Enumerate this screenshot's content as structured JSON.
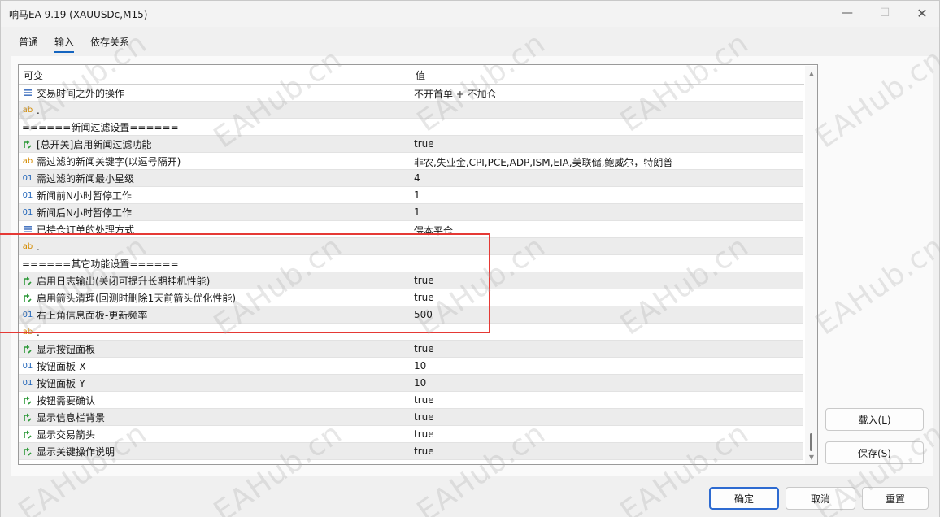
{
  "window": {
    "title": "响马EA 9.19 (XAUUSDc,M15)",
    "minimize": "—",
    "maximize": "☐",
    "close": "✕"
  },
  "tabs": [
    {
      "label": "普通",
      "active": false
    },
    {
      "label": "输入",
      "active": true
    },
    {
      "label": "依存关系",
      "active": false
    }
  ],
  "grid": {
    "col_variable": "可变",
    "col_value": "值",
    "rows": [
      {
        "icon": "menu",
        "name": "交易时间之外的操作",
        "value": "不开首单 + 不加仓"
      },
      {
        "icon": "ab",
        "name": ".",
        "value": ""
      },
      {
        "icon": "",
        "name": "======新闻过滤设置======",
        "value": ""
      },
      {
        "icon": "bool",
        "name": "[总开关]启用新闻过滤功能",
        "value": "true"
      },
      {
        "icon": "ab",
        "name": "需过滤的新闻关键字(以逗号隔开)",
        "value": "非农,失业金,CPI,PCE,ADP,ISM,EIA,美联储,鲍威尔，特朗普"
      },
      {
        "icon": "01",
        "name": "需过滤的新闻最小星级",
        "value": "4"
      },
      {
        "icon": "01",
        "name": "新闻前N小时暂停工作",
        "value": "1"
      },
      {
        "icon": "01",
        "name": "新闻后N小时暂停工作",
        "value": "1"
      },
      {
        "icon": "menu",
        "name": "已持仓订单的处理方式",
        "value": "保本平仓"
      },
      {
        "icon": "ab",
        "name": ".",
        "value": ""
      },
      {
        "icon": "",
        "name": "======其它功能设置======",
        "value": ""
      },
      {
        "icon": "bool",
        "name": "启用日志输出(关闭可提升长期挂机性能)",
        "value": "true"
      },
      {
        "icon": "bool",
        "name": "启用箭头清理(回测时删除1天前箭头优化性能)",
        "value": "true"
      },
      {
        "icon": "01",
        "name": "右上角信息面板-更新频率",
        "value": "500"
      },
      {
        "icon": "ab",
        "name": ".",
        "value": ""
      },
      {
        "icon": "bool",
        "name": "显示按钮面板",
        "value": "true"
      },
      {
        "icon": "01",
        "name": "按钮面板-X",
        "value": "10"
      },
      {
        "icon": "01",
        "name": "按钮面板-Y",
        "value": "10"
      },
      {
        "icon": "bool",
        "name": "按钮需要确认",
        "value": "true"
      },
      {
        "icon": "bool",
        "name": "显示信息栏背景",
        "value": "true"
      },
      {
        "icon": "bool",
        "name": "显示交易箭头",
        "value": "true"
      },
      {
        "icon": "bool",
        "name": "显示关键操作说明",
        "value": "true"
      }
    ]
  },
  "buttons": {
    "load": "载入(L)",
    "save": "保存(S)",
    "ok": "确定",
    "cancel": "取消",
    "reset": "重置"
  },
  "watermark_text": "EAHub.cn",
  "colors": {
    "accent": "#2e6bd1",
    "highlight_box": "#e53935",
    "ab_icon": "#d48b00",
    "num_icon": "#1e63b8",
    "bool_icon": "#2e9a3a"
  }
}
